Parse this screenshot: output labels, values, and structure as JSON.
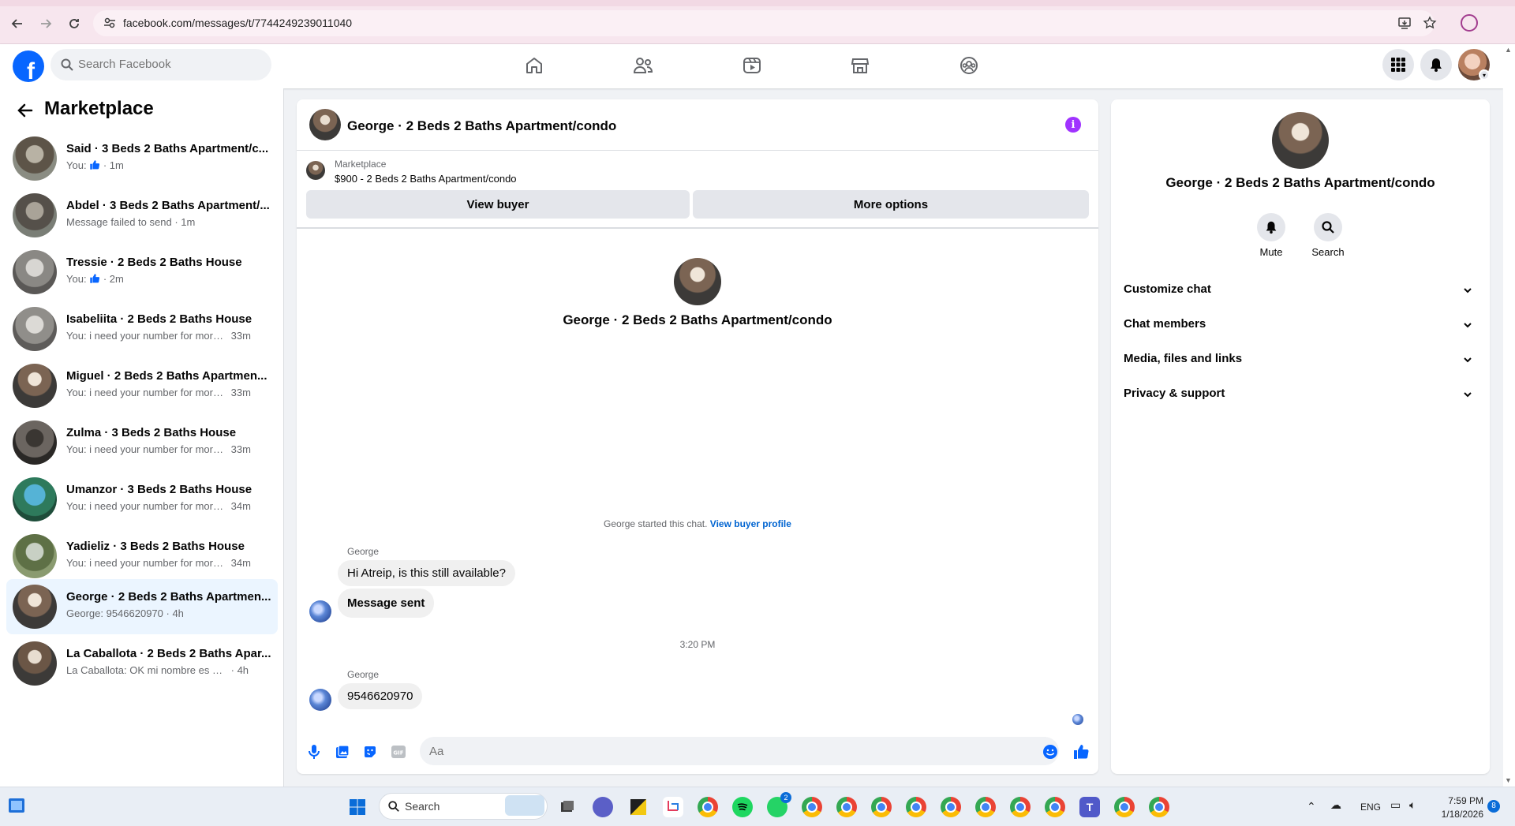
{
  "browser": {
    "url": "facebook.com/messages/t/7744249239011040"
  },
  "header": {
    "search_placeholder": "Search Facebook"
  },
  "sidebar": {
    "title": "Marketplace",
    "conversations": [
      {
        "name": "Said · 3 Beds 2 Baths Apartment/c...",
        "preview": "You:",
        "has_like": true,
        "time": "· 1m"
      },
      {
        "name": "Abdel · 3 Beds 2 Baths Apartment/...",
        "preview": "Message failed to send",
        "has_like": false,
        "time": "· 1m"
      },
      {
        "name": "Tressie · 2 Beds 2 Baths House",
        "preview": "You:",
        "has_like": true,
        "time": "· 2m"
      },
      {
        "name": "Isabeliita · 2 Beds 2 Baths House",
        "preview": "You: i need your number for more in...",
        "has_like": false,
        "time": "33m"
      },
      {
        "name": "Miguel · 2 Beds 2 Baths Apartmen...",
        "preview": "You: i need your number for more in...",
        "has_like": false,
        "time": "33m"
      },
      {
        "name": "Zulma · 3 Beds 2 Baths House",
        "preview": "You: i need your number for more in...",
        "has_like": false,
        "time": "33m"
      },
      {
        "name": "Umanzor · 3 Beds 2 Baths House",
        "preview": "You: i need your number for more in...",
        "has_like": false,
        "time": "34m"
      },
      {
        "name": "Yadieliz · 3 Beds 2 Baths House",
        "preview": "You: i need your number for more in...",
        "has_like": false,
        "time": "34m"
      },
      {
        "name": "George · 2 Beds 2 Baths Apartmen...",
        "preview": "George: 9546620970",
        "has_like": false,
        "time": "· 4h",
        "active": true
      },
      {
        "name": "La Caballota · 2 Beds 2 Baths Apar...",
        "preview": "La Caballota: OK mi nombre es marib...",
        "has_like": false,
        "time": "· 4h"
      }
    ]
  },
  "chat": {
    "title": "George · 2 Beds 2 Baths Apartment/condo",
    "marketplace_label": "Marketplace",
    "listing": "$900 - 2 Beds 2 Baths Apartment/condo",
    "view_buyer": "View buyer",
    "more_options": "More options",
    "center_title": "George · 2 Beds 2 Baths Apartment/condo",
    "started_text": "George started this chat.",
    "view_buyer_profile": "View buyer profile",
    "sender1": "George",
    "msg1": "Hi Atreip, is this still available?",
    "msg2": "Message sent",
    "time_sep": "3:20 PM",
    "sender2": "George",
    "msg3": "9546620970",
    "composer_placeholder": "Aa"
  },
  "details": {
    "title": "George · 2 Beds 2 Baths Apartment/condo",
    "mute": "Mute",
    "search": "Search",
    "sections": [
      "Customize chat",
      "Chat members",
      "Media, files and links",
      "Privacy & support"
    ]
  },
  "taskbar": {
    "search_label": "Search",
    "lang": "ENG",
    "time": "7:59 PM",
    "date": "1/18/2026",
    "whatsapp_badge": "2",
    "notif_count": "8"
  },
  "colors": {
    "fb_blue": "#0866ff",
    "active_conv_bg": "#ebf5ff",
    "info_purple": "#a033ff",
    "link_blue": "#0064d1"
  }
}
